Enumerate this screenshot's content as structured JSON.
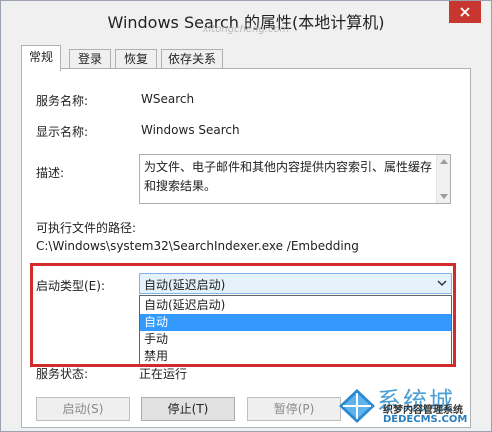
{
  "window": {
    "title": "Windows Search 的属性(本地计算机)",
    "watermark_url": "xitongcheng.com"
  },
  "tabs": [
    {
      "label": "常规",
      "active": true
    },
    {
      "label": "登录",
      "active": false
    },
    {
      "label": "恢复",
      "active": false
    },
    {
      "label": "依存关系",
      "active": false
    }
  ],
  "general": {
    "service_name_label": "服务名称:",
    "service_name_value": "WSearch",
    "display_name_label": "显示名称:",
    "display_name_value": "Windows Search",
    "description_label": "描述:",
    "description_value": "为文件、电子邮件和其他内容提供内容索引、属性缓存和搜索结果。",
    "exec_path_label": "可执行文件的路径:",
    "exec_path_value": "C:\\Windows\\system32\\SearchIndexer.exe /Embedding",
    "startup_type_label": "启动类型(E):",
    "startup_type_value": "自动(延迟启动)",
    "startup_options": [
      "自动(延迟启动)",
      "自动",
      "手动",
      "禁用"
    ],
    "highlighted_option_index": 1,
    "status_label": "服务状态:",
    "status_value": "正在运行"
  },
  "buttons": {
    "start": "启动(S)",
    "stop": "停止(T)",
    "pause": "暂停(P)"
  },
  "watermark": {
    "brand": "系统城",
    "site_name": "织梦内容管理系统",
    "site_url": "DEDECMS.COM"
  },
  "colors": {
    "selection": "#3399ff",
    "highlight_border": "#d22b2b",
    "close_button": "#c7372f"
  }
}
